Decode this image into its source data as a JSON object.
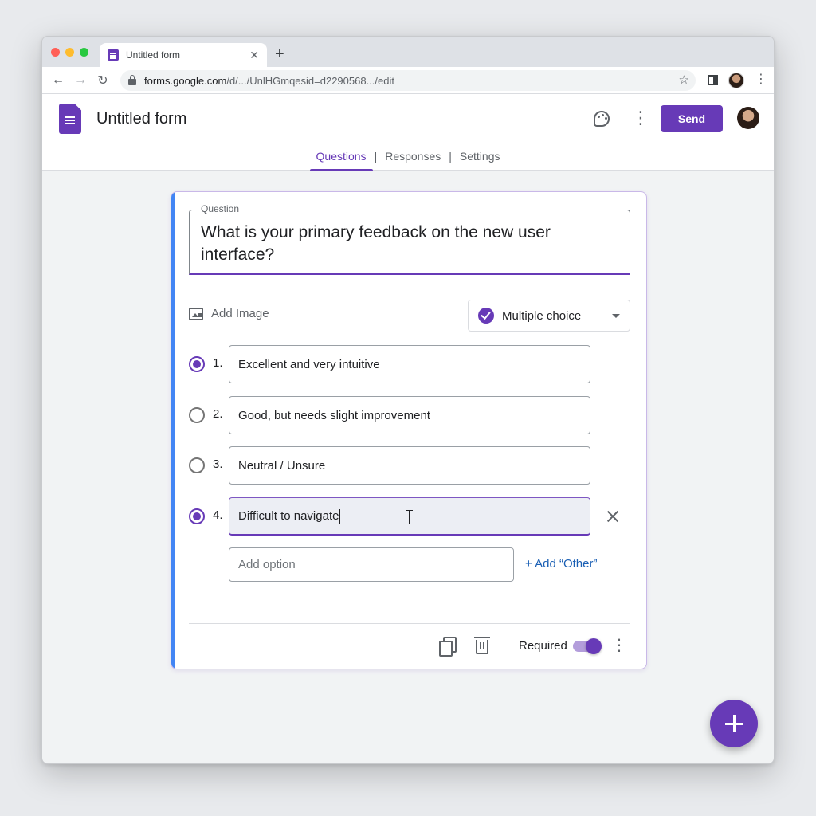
{
  "browser": {
    "tab_title": "Untitled form",
    "tab_close_glyph": "✕",
    "new_tab_glyph": "+",
    "back_glyph": "←",
    "forward_glyph": "→",
    "reload_glyph": "↻",
    "url_host": "forms.google.com",
    "url_path": "/d/.../UnlHGmqesid=d2290568.../edit",
    "bookmark_glyph": "☆",
    "menu_glyph": "⋮"
  },
  "header": {
    "form_title": "Untitled form",
    "menu_glyph": "⋮",
    "send_label": "Send",
    "tabs": [
      {
        "label": "Questions",
        "active": true
      },
      {
        "label": "Responses",
        "active": false
      },
      {
        "label": "Settings",
        "active": false
      }
    ],
    "tab_separator": "|"
  },
  "question": {
    "field_label": "Question",
    "text": "What is your primary feedback on the new user interface?",
    "add_image_label": "Add Image",
    "type_label": "Multiple choice",
    "options": [
      {
        "number": "1.",
        "text": "Excellent and very intuitive",
        "selected": true
      },
      {
        "number": "2.",
        "text": "Good, but needs slight improvement",
        "selected": false
      },
      {
        "number": "3.",
        "text": "Neutral / Unsure",
        "selected": false
      },
      {
        "number": "4.",
        "text": "Difficult to navigate",
        "selected": true,
        "focused": true
      }
    ],
    "add_option_placeholder": "Add option",
    "add_other_label": "+ Add “Other”",
    "required_label": "Required",
    "required_on": true,
    "menu_glyph": "⋮"
  },
  "colors": {
    "accent": "#673ab7",
    "accent_light": "#b39ddb",
    "card_left_bar": "#4285f4",
    "link": "#1a5fb4"
  },
  "icons": [
    "lock-icon",
    "star-icon",
    "side-panel-icon",
    "forms-logo-icon",
    "palette-icon",
    "image-icon",
    "check-circle-icon",
    "dropdown-arrow-icon",
    "close-icon",
    "copy-icon",
    "trash-icon",
    "add-icon"
  ]
}
